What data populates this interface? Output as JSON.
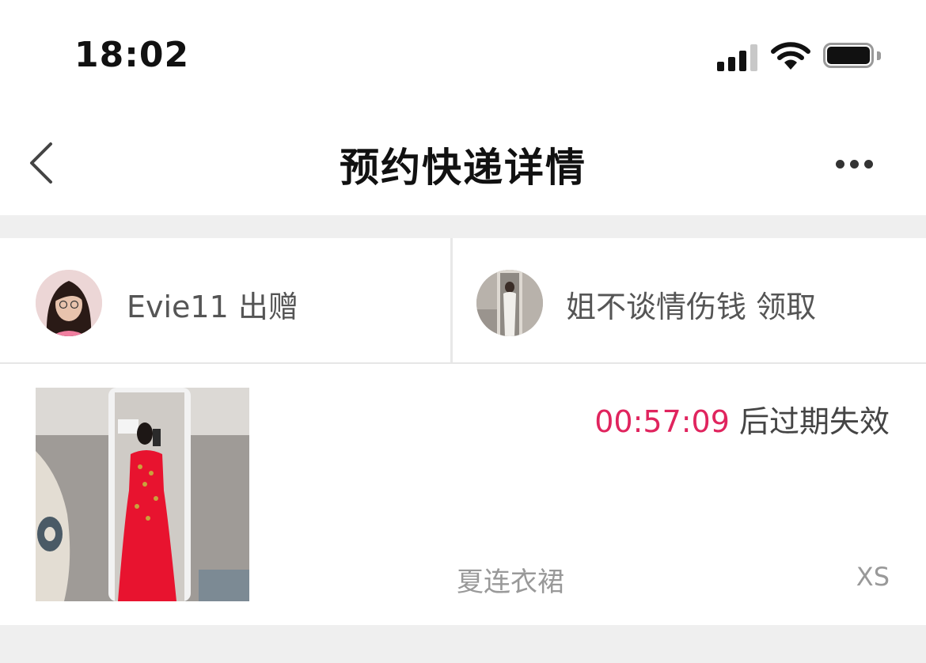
{
  "status_bar": {
    "time": "18:02"
  },
  "nav": {
    "title": "预约快递详情"
  },
  "donor": {
    "text": "Evie11 出赠"
  },
  "receiver": {
    "text": "姐不谈情伤钱 领取"
  },
  "item": {
    "countdown": "00:57:09",
    "countdown_suffix": " 后过期失效",
    "category": "夏连衣裙",
    "size": "XS"
  },
  "colors": {
    "accent": "#e0245e",
    "background": "#efefef"
  }
}
